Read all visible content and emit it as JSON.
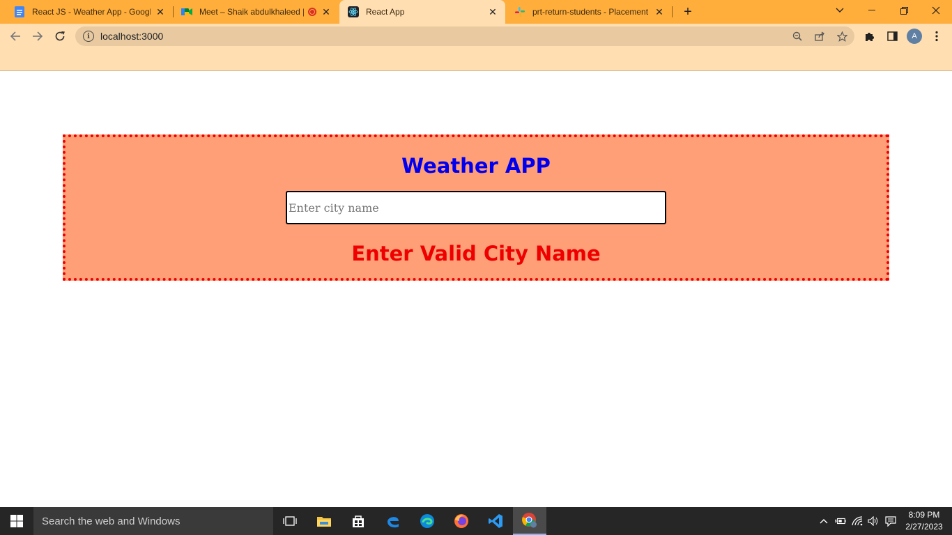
{
  "browser": {
    "tabs": [
      {
        "title": "React JS - Weather App - Google",
        "icon": "google-docs-icon"
      },
      {
        "title": "Meet – Shaik abdulkhaleed |",
        "icon": "google-meet-icon"
      },
      {
        "title": "React App",
        "icon": "react-icon"
      },
      {
        "title": "prt-return-students - Placement",
        "icon": "slack-icon"
      }
    ],
    "url": "localhost:3000",
    "profile_initial": "A"
  },
  "app": {
    "title": "Weather APP",
    "city_input": {
      "placeholder": "Enter city name",
      "value": ""
    },
    "error_message": "Enter Valid City Name",
    "colors": {
      "box_bg": "#ff9f78",
      "box_border": "#ee0000",
      "title": "#0000ee",
      "error": "#ee0000"
    }
  },
  "taskbar": {
    "search_placeholder": "Search the web and Windows",
    "time": "8:09 PM",
    "date": "2/27/2023"
  }
}
